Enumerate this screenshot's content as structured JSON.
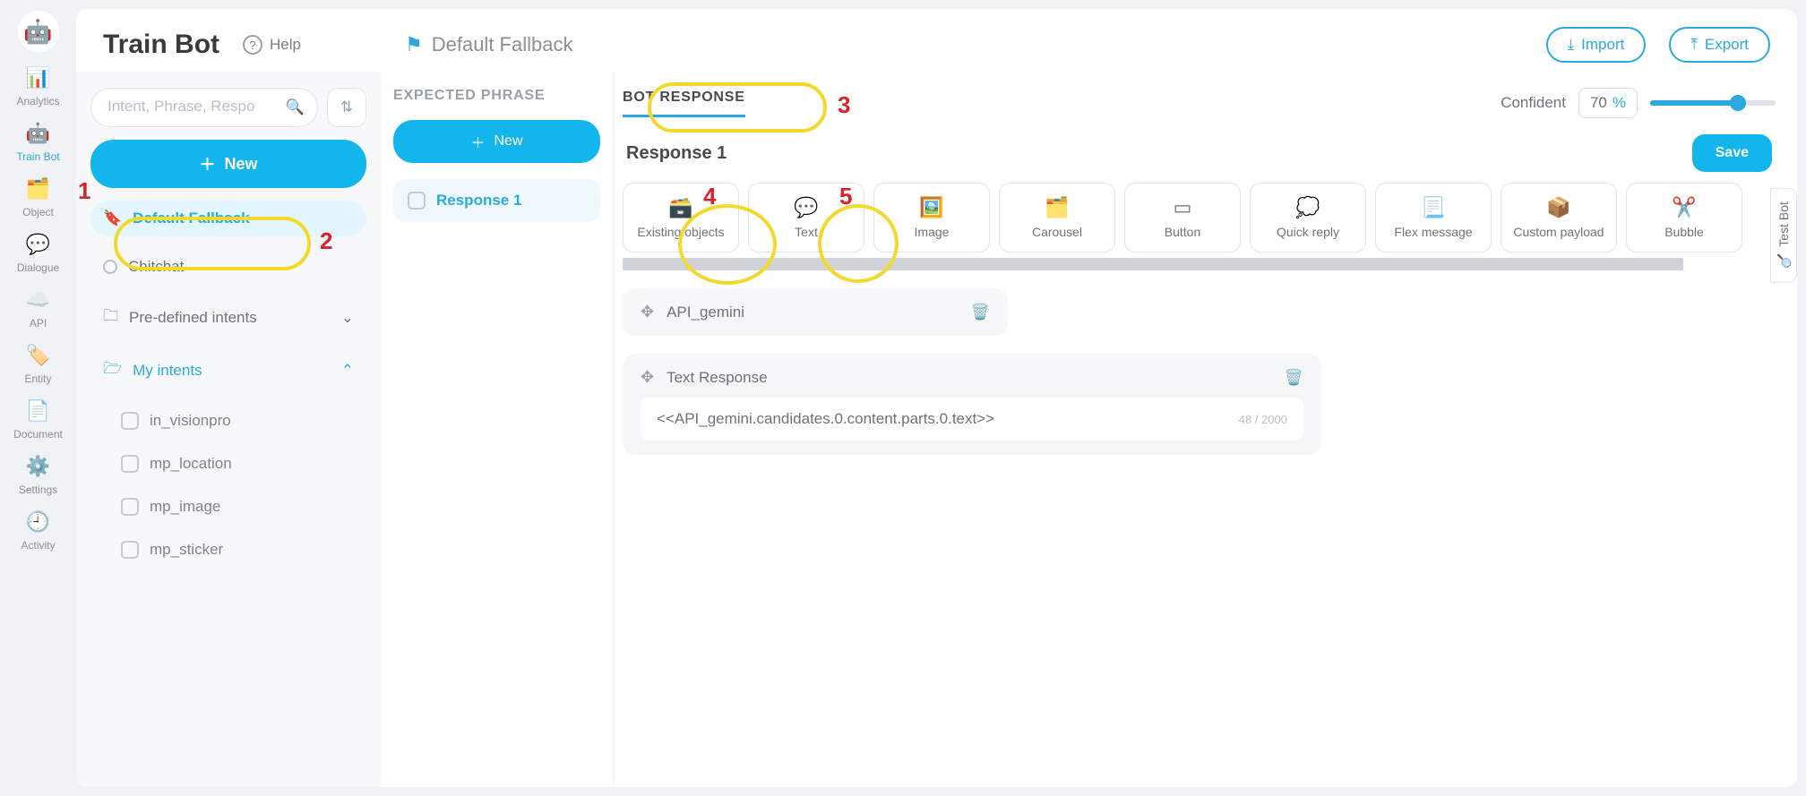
{
  "header": {
    "title": "Train Bot",
    "help": "Help",
    "breadcrumb": "Default Fallback",
    "import": "Import",
    "export": "Export"
  },
  "rail": {
    "items": [
      {
        "label": "Analytics"
      },
      {
        "label": "Train Bot"
      },
      {
        "label": "Object"
      },
      {
        "label": "Dialogue"
      },
      {
        "label": "API"
      },
      {
        "label": "Entity"
      },
      {
        "label": "Document"
      },
      {
        "label": "Settings"
      },
      {
        "label": "Activity"
      }
    ]
  },
  "sidebar": {
    "search_placeholder": "Intent, Phrase, Respo",
    "new": "New",
    "items": {
      "fallback": "Default Fallback",
      "chitchat": "Chitchat",
      "predefined": "Pre-defined intents",
      "myintents": "My intents"
    },
    "subs": [
      "in_visionpro",
      "mp_location",
      "mp_image",
      "mp_sticker"
    ]
  },
  "mid": {
    "tab": "EXPECTED PHRASE",
    "new": "New",
    "item": "Response 1"
  },
  "content": {
    "tab_response": "BOT RESPONSE",
    "confident_label": "Confident",
    "confident_value": "70",
    "percent": "%",
    "response_title": "Response 1",
    "save": "Save",
    "blocks": [
      "Existing objects",
      "Text",
      "Image",
      "Carousel",
      "Button",
      "Quick reply",
      "Flex message",
      "Custom payload",
      "Bubble"
    ],
    "card1": "API_gemini",
    "card2_title": "Text Response",
    "card2_text": "<<API_gemini.candidates.0.content.parts.0.text>>",
    "card2_count": "48 / 2000",
    "testbot": "Test Bot"
  },
  "annotations": {
    "n1": "1",
    "n2": "2",
    "n3": "3",
    "n4": "4",
    "n5": "5"
  }
}
